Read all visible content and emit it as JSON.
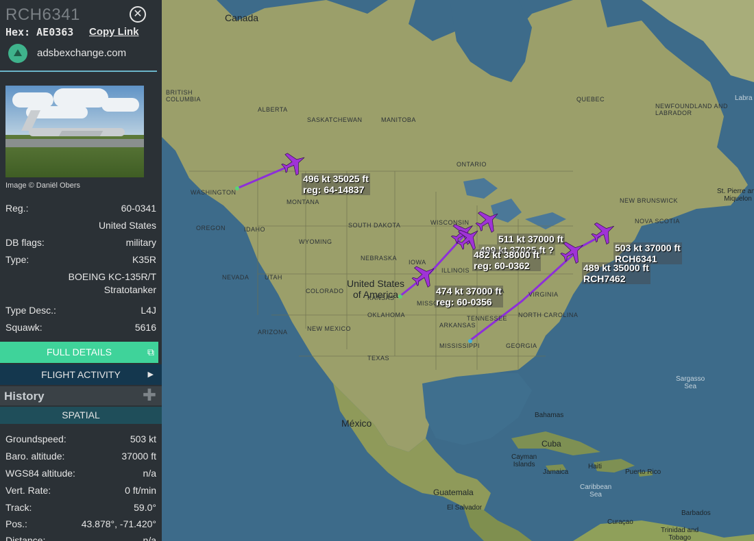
{
  "sidebar": {
    "callsign": "RCH6341",
    "hex_label": "Hex:",
    "hex": "AE0363",
    "copy_link": "Copy Link",
    "site": "adsbexchange.com",
    "photo_credit": "Image © Daniël Obers",
    "details": {
      "reg_label": "Reg.:",
      "reg": "60-0341",
      "country": "United States",
      "db_flags_label": "DB flags:",
      "db_flags": "military",
      "type_label": "Type:",
      "type": "K35R",
      "type_name_1": "BOEING KC-135R/T",
      "type_name_2": "Stratotanker",
      "type_desc_label": "Type Desc.:",
      "type_desc": "L4J",
      "squawk_label": "Squawk:",
      "squawk": "5616"
    },
    "full_details": "FULL DETAILS",
    "flight_activity": "FLIGHT ACTIVITY",
    "history": "History",
    "spatial": "SPATIAL",
    "spatial_rows": [
      {
        "label": "Groundspeed:",
        "value": "503 kt"
      },
      {
        "label": "Baro. altitude:",
        "value": "37000 ft"
      },
      {
        "label": "WGS84 altitude:",
        "value": "n/a"
      },
      {
        "label": "Vert. Rate:",
        "value": "0 ft/min"
      },
      {
        "label": "Track:",
        "value": "59.0°"
      },
      {
        "label": "Pos.:",
        "value": "43.878°, -71.420°"
      },
      {
        "label": "Distance:",
        "value": "n/a"
      }
    ]
  },
  "map": {
    "labels": {
      "canada": "Canada",
      "usa_1": "United States",
      "usa_2": "of America",
      "mexico": "México",
      "bc_1": "BRITISH",
      "bc_2": "COLUMBIA",
      "alberta": "ALBERTA",
      "saskatchewan": "SASKATCHEWAN",
      "manitoba": "MANITOBA",
      "ontario": "ONTARIO",
      "quebec": "QUEBEC",
      "newfoundland_1": "NEWFOUNDLAND AND",
      "newfoundland_2": "LABRADOR",
      "new_brunswick": "NEW BRUNSWICK",
      "nova_scotia": "NOVA SCOTIA",
      "washington": "WASHINGTON",
      "oregon": "OREGON",
      "idaho": "IDAHO",
      "montana": "MONTANA",
      "wyoming": "WYOMING",
      "south_dakota": "SOUTH DAKOTA",
      "nebraska": "NEBRASKA",
      "kansas": "KANSAS",
      "oklahoma": "OKLAHOMA",
      "texas": "TEXAS",
      "new_mexico": "NEW MEXICO",
      "arizona": "ARIZONA",
      "nevada": "NEVADA",
      "utah": "UTAH",
      "colorado": "COLORADO",
      "illinois": "ILLINOIS",
      "indiana": "INDIANA",
      "arkansas": "ARKANSAS",
      "mississippi": "MISSISSIPPI",
      "georgia": "GEORGIA",
      "virginia": "VIRGINIA",
      "wisconsin": "WISCONSIN",
      "iowa": "IOWA",
      "missouri": "MISSOURI",
      "tennessee": "TENNESSEE",
      "north_carolina": "NORTH CAROLINA",
      "st_pierre_1": "St. Pierre and",
      "st_pierre_2": "Miquelon",
      "labrador_sea": "Labra Se",
      "sargasso_1": "Sargasso",
      "sargasso_2": "Sea",
      "bahamas": "Bahamas",
      "cuba": "Cuba",
      "cayman_1": "Cayman",
      "cayman_2": "Islands",
      "jamaica": "Jamaica",
      "haiti": "Haiti",
      "puerto_rico": "Puerto Rico",
      "caribbean_1": "Caribbean",
      "caribbean_2": "Sea",
      "guatemala": "Guatemala",
      "el_salvador": "El Salvador",
      "curacao": "Curaçao",
      "barbados": "Barbados",
      "trinidad_1": "Trinidad and",
      "trinidad_2": "Tobago"
    },
    "aircraft": [
      {
        "line1": "496 kt  35025 ft",
        "line2": "reg: 64-14837"
      },
      {
        "line1": "511 kt  37000 ft",
        "line2": ""
      },
      {
        "line1": "499 kt  37025 ft  ?",
        "line2": ""
      },
      {
        "line1": "482 kt  38000 ft",
        "line2": "reg: 60-0362"
      },
      {
        "line1": "474 kt  37000 ft",
        "line2": "reg: 60-0356"
      },
      {
        "line1": "503 kt  37000 ft",
        "line2": "RCH6341"
      },
      {
        "line1": "489 kt  35000 ft",
        "line2": "RCH7462"
      }
    ],
    "colors": {
      "aircraft": "#a033d6",
      "track": "#8d2fd9",
      "land": "#a9a46f",
      "water": "#3d6b8a"
    }
  }
}
